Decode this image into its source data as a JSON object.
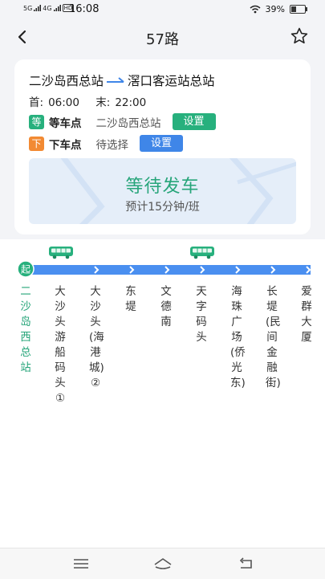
{
  "status": {
    "network1": "5G",
    "network2": "4G",
    "hd": "HD",
    "time": "16:08",
    "battery": "39%"
  },
  "header": {
    "title": "57路"
  },
  "route": {
    "from": "二沙岛西总站",
    "to": "滘口客运站总站",
    "first_label": "首:",
    "first_time": "06:00",
    "last_label": "末:",
    "last_time": "22:00"
  },
  "boarding": {
    "tag": "等",
    "label": "等车点",
    "value": "二沙岛西总站",
    "button": "设置"
  },
  "alighting": {
    "tag": "下",
    "label": "下车点",
    "value": "待选择",
    "button": "设置"
  },
  "status_box": {
    "title": "等待发车",
    "subtitle": "预计15分钟/班"
  },
  "line": {
    "start_badge": "起",
    "stops": [
      "二沙岛西总站",
      "大沙头游船码头①",
      "大沙头(海港城)②",
      "东堤",
      "文德南",
      "天字码头",
      "海珠广场(侨光东)",
      "长堤(民间金融街)",
      "爱群大厦"
    ]
  },
  "colors": {
    "accent_green": "#27b07d",
    "accent_blue": "#3f86e8",
    "accent_orange": "#f28a33",
    "line_blue": "#4a8ff0"
  },
  "icons": {
    "back": "back-arrow-icon",
    "favorite": "star-icon",
    "bus": "bus-icon",
    "menu": "menu-icon",
    "home": "home-icon",
    "back_nav": "back-nav-icon"
  }
}
